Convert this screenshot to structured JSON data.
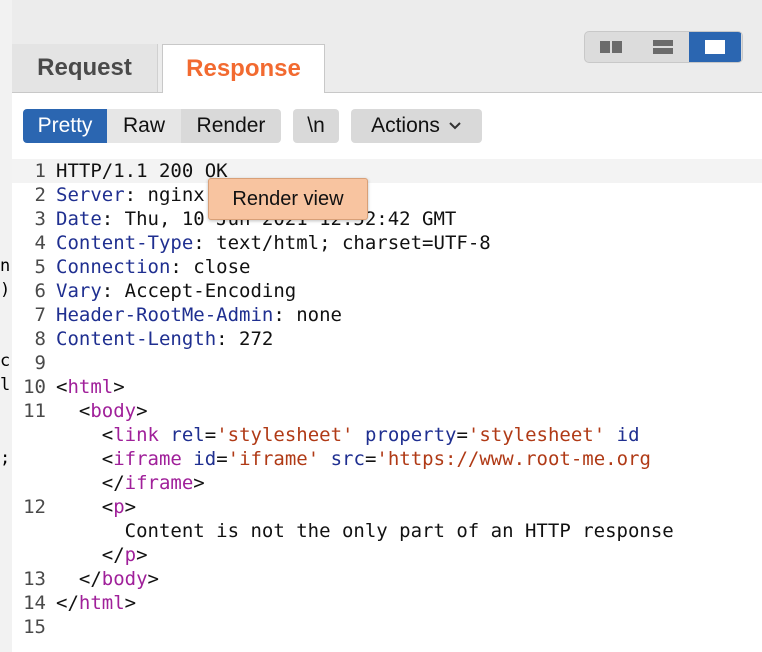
{
  "tabs": {
    "request": "Request",
    "response": "Response"
  },
  "toolbar": {
    "pretty": "Pretty",
    "raw": "Raw",
    "render": "Render",
    "newline": "\\n",
    "actions": "Actions"
  },
  "tooltip": "Render view",
  "left_fragments": [
    "n",
    ")",
    "c",
    "l",
    ";"
  ],
  "colors": {
    "accent": "#2b66b1",
    "response_tab": "#f26a30",
    "tooltip_bg": "#f8c4a0"
  },
  "lines": [
    {
      "n": "1",
      "segs": [
        [
          "plain",
          "HTTP/1.1 200 OK"
        ]
      ]
    },
    {
      "n": "2",
      "segs": [
        [
          "hk",
          "Server"
        ],
        [
          "plain",
          ": nginx"
        ]
      ]
    },
    {
      "n": "3",
      "segs": [
        [
          "hk",
          "Date"
        ],
        [
          "plain",
          ": Thu, 10 Jun 2021 12:52:42 GMT"
        ]
      ]
    },
    {
      "n": "4",
      "segs": [
        [
          "hk",
          "Content-Type"
        ],
        [
          "plain",
          ": text/html; charset=UTF-8"
        ]
      ]
    },
    {
      "n": "5",
      "segs": [
        [
          "hk",
          "Connection"
        ],
        [
          "plain",
          ": close"
        ]
      ]
    },
    {
      "n": "6",
      "segs": [
        [
          "hk",
          "Vary"
        ],
        [
          "plain",
          ": Accept-Encoding"
        ]
      ]
    },
    {
      "n": "7",
      "segs": [
        [
          "hk",
          "Header-RootMe-Admin"
        ],
        [
          "plain",
          ": none"
        ]
      ]
    },
    {
      "n": "8",
      "segs": [
        [
          "hk",
          "Content-Length"
        ],
        [
          "plain",
          ": 272"
        ]
      ]
    },
    {
      "n": "9",
      "segs": []
    },
    {
      "n": "10",
      "segs": [
        [
          "plain",
          "<"
        ],
        [
          "tag",
          "html"
        ],
        [
          "plain",
          ">"
        ]
      ]
    },
    {
      "n": "11",
      "segs": [
        [
          "plain",
          "  <"
        ],
        [
          "tag",
          "body"
        ],
        [
          "plain",
          ">"
        ]
      ]
    },
    {
      "n": "",
      "segs": [
        [
          "plain",
          "    <"
        ],
        [
          "tag",
          "link"
        ],
        [
          "plain",
          " "
        ],
        [
          "attr",
          "rel"
        ],
        [
          "plain",
          "="
        ],
        [
          "str",
          "'stylesheet'"
        ],
        [
          "plain",
          " "
        ],
        [
          "attr",
          "property"
        ],
        [
          "plain",
          "="
        ],
        [
          "str",
          "'stylesheet'"
        ],
        [
          "plain",
          " "
        ],
        [
          "attr",
          "id"
        ]
      ]
    },
    {
      "n": "",
      "segs": [
        [
          "plain",
          "    <"
        ],
        [
          "tag",
          "iframe"
        ],
        [
          "plain",
          " "
        ],
        [
          "attr",
          "id"
        ],
        [
          "plain",
          "="
        ],
        [
          "str",
          "'iframe'"
        ],
        [
          "plain",
          " "
        ],
        [
          "attr",
          "src"
        ],
        [
          "plain",
          "="
        ],
        [
          "str",
          "'https://www.root-me.org"
        ]
      ]
    },
    {
      "n": "",
      "segs": [
        [
          "plain",
          "    </"
        ],
        [
          "tag",
          "iframe"
        ],
        [
          "plain",
          ">"
        ]
      ]
    },
    {
      "n": "12",
      "segs": [
        [
          "plain",
          "    <"
        ],
        [
          "tag",
          "p"
        ],
        [
          "plain",
          ">"
        ]
      ]
    },
    {
      "n": "",
      "segs": [
        [
          "plain",
          "      Content is not the only part of an HTTP response"
        ]
      ]
    },
    {
      "n": "",
      "segs": [
        [
          "plain",
          "    </"
        ],
        [
          "tag",
          "p"
        ],
        [
          "plain",
          ">"
        ]
      ]
    },
    {
      "n": "13",
      "segs": [
        [
          "plain",
          "  </"
        ],
        [
          "tag",
          "body"
        ],
        [
          "plain",
          ">"
        ]
      ]
    },
    {
      "n": "14",
      "segs": [
        [
          "plain",
          "</"
        ],
        [
          "tag",
          "html"
        ],
        [
          "plain",
          ">"
        ]
      ]
    },
    {
      "n": "15",
      "segs": []
    }
  ]
}
